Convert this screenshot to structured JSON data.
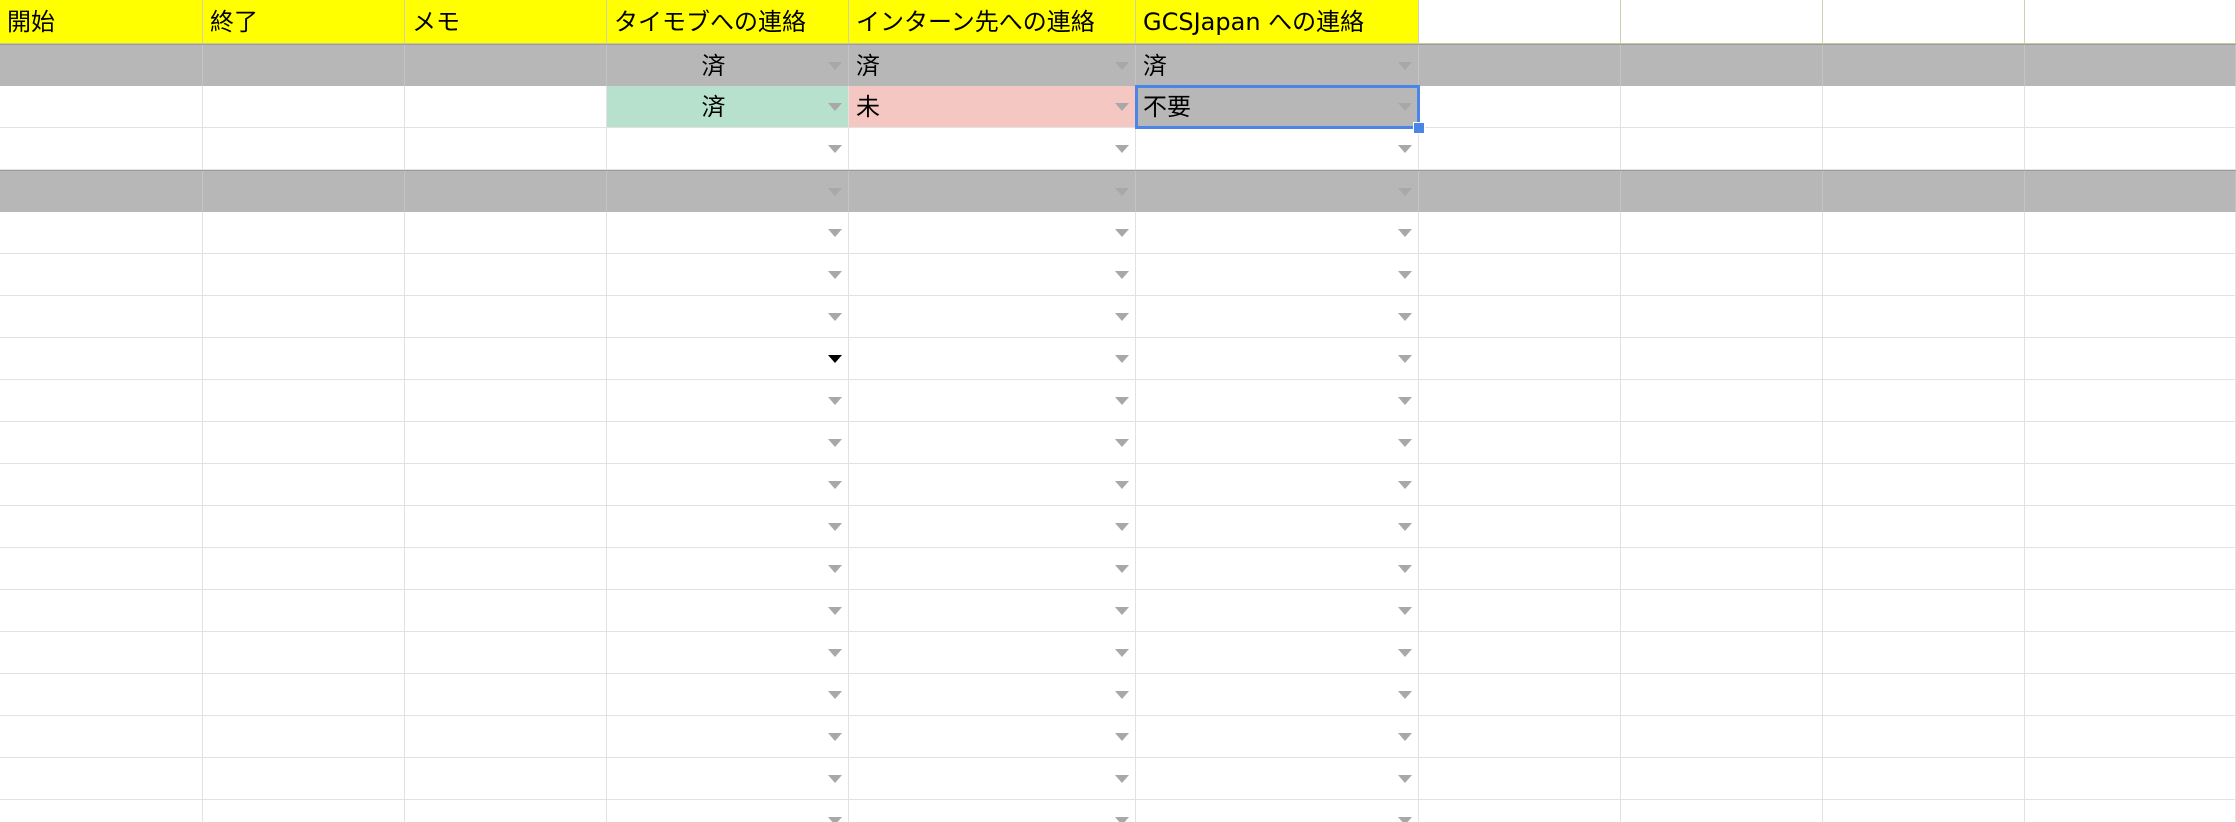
{
  "colors": {
    "header_bg": "#ffff00",
    "gray_row_bg": "#b7b7b7",
    "status_done_bg": "#b7e1cd",
    "status_pending_bg": "#f4c7c3",
    "selection": "#4a86e8",
    "gridline": "#e2e2e2"
  },
  "header": [
    "開始",
    "終了",
    "メモ",
    "タイモブへの連絡",
    "インターン先への連絡",
    "GCSJapan への連絡",
    "",
    "",
    "",
    ""
  ],
  "rows": [
    {
      "style": "gray",
      "cells": [
        "",
        "",
        "",
        "済",
        "済",
        "済",
        "",
        "",
        "",
        ""
      ]
    },
    {
      "style": "white",
      "cells": [
        "",
        "",
        "",
        "済",
        "未",
        "不要",
        "",
        "",
        "",
        ""
      ]
    },
    {
      "style": "white",
      "cells": [
        "",
        "",
        "",
        "",
        "",
        "",
        "",
        "",
        "",
        ""
      ]
    },
    {
      "style": "gray",
      "cells": [
        "",
        "",
        "",
        "",
        "",
        "",
        "",
        "",
        "",
        ""
      ]
    },
    {
      "style": "white",
      "cells": [
        "",
        "",
        "",
        "",
        "",
        "",
        "",
        "",
        "",
        ""
      ]
    },
    {
      "style": "white",
      "cells": [
        "",
        "",
        "",
        "",
        "",
        "",
        "",
        "",
        "",
        ""
      ]
    },
    {
      "style": "white",
      "cells": [
        "",
        "",
        "",
        "",
        "",
        "",
        "",
        "",
        "",
        ""
      ]
    },
    {
      "style": "white",
      "cells": [
        "",
        "",
        "",
        "",
        "",
        "",
        "",
        "",
        "",
        ""
      ]
    },
    {
      "style": "white",
      "cells": [
        "",
        "",
        "",
        "",
        "",
        "",
        "",
        "",
        "",
        ""
      ]
    },
    {
      "style": "white",
      "cells": [
        "",
        "",
        "",
        "",
        "",
        "",
        "",
        "",
        "",
        ""
      ]
    },
    {
      "style": "white",
      "cells": [
        "",
        "",
        "",
        "",
        "",
        "",
        "",
        "",
        "",
        ""
      ]
    },
    {
      "style": "white",
      "cells": [
        "",
        "",
        "",
        "",
        "",
        "",
        "",
        "",
        "",
        ""
      ]
    },
    {
      "style": "white",
      "cells": [
        "",
        "",
        "",
        "",
        "",
        "",
        "",
        "",
        "",
        ""
      ]
    },
    {
      "style": "white",
      "cells": [
        "",
        "",
        "",
        "",
        "",
        "",
        "",
        "",
        "",
        ""
      ]
    },
    {
      "style": "white",
      "cells": [
        "",
        "",
        "",
        "",
        "",
        "",
        "",
        "",
        "",
        ""
      ]
    },
    {
      "style": "white",
      "cells": [
        "",
        "",
        "",
        "",
        "",
        "",
        "",
        "",
        "",
        ""
      ]
    },
    {
      "style": "white",
      "cells": [
        "",
        "",
        "",
        "",
        "",
        "",
        "",
        "",
        "",
        ""
      ]
    },
    {
      "style": "white",
      "cells": [
        "",
        "",
        "",
        "",
        "",
        "",
        "",
        "",
        "",
        ""
      ]
    },
    {
      "style": "white",
      "cells": [
        "",
        "",
        "",
        "",
        "",
        "",
        "",
        "",
        "",
        ""
      ]
    }
  ],
  "cell_fills": {
    "1.3": "status_done",
    "1.4": "status_pending",
    "1.5": "gray"
  },
  "dropdown_columns": [
    3,
    4,
    5
  ],
  "dropdown_open_icon": "dropdown-arrow-icon",
  "selected_cell": "row 2, column GCSJapan への連絡"
}
